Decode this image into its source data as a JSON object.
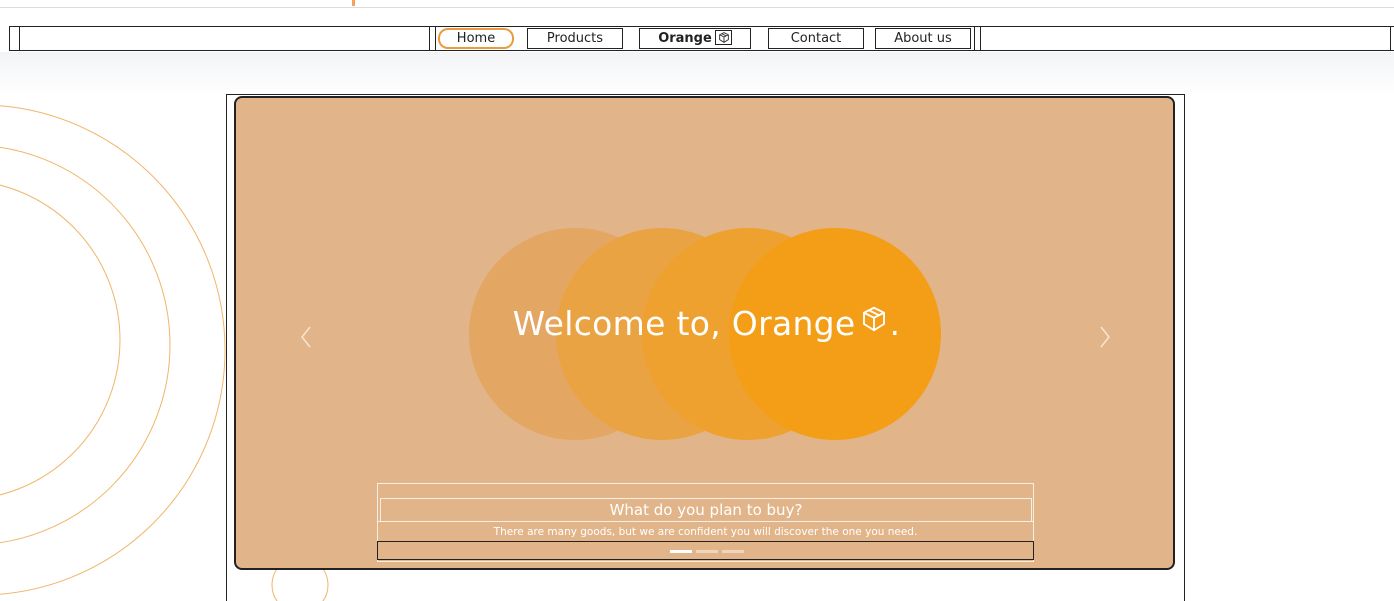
{
  "nav": {
    "items": [
      {
        "label": "Home",
        "active": true
      },
      {
        "label": "Products"
      },
      {
        "label": "Orange",
        "icon": "box-icon"
      },
      {
        "label": "Contact"
      },
      {
        "label": "About us"
      }
    ]
  },
  "hero": {
    "title": "Welcome to, Orange",
    "title_suffix": ".",
    "icon": "box-icon",
    "caption_heading": "What do you plan to buy?",
    "caption_body": "There are many goods, but we are confident you will discover the one you need.",
    "slide_count": 3,
    "active_slide": 1
  },
  "colors": {
    "accent": "#e99b3e",
    "carousel_bg": "#e1b589",
    "circle_1": "#e3a763",
    "circle_2": "#eaa343",
    "circle_3": "#efa12f",
    "circle_4": "#f39e16",
    "deco_lines": "#f0b56a"
  },
  "icons": {
    "prev": "chevron-left-icon",
    "next": "chevron-right-icon"
  }
}
